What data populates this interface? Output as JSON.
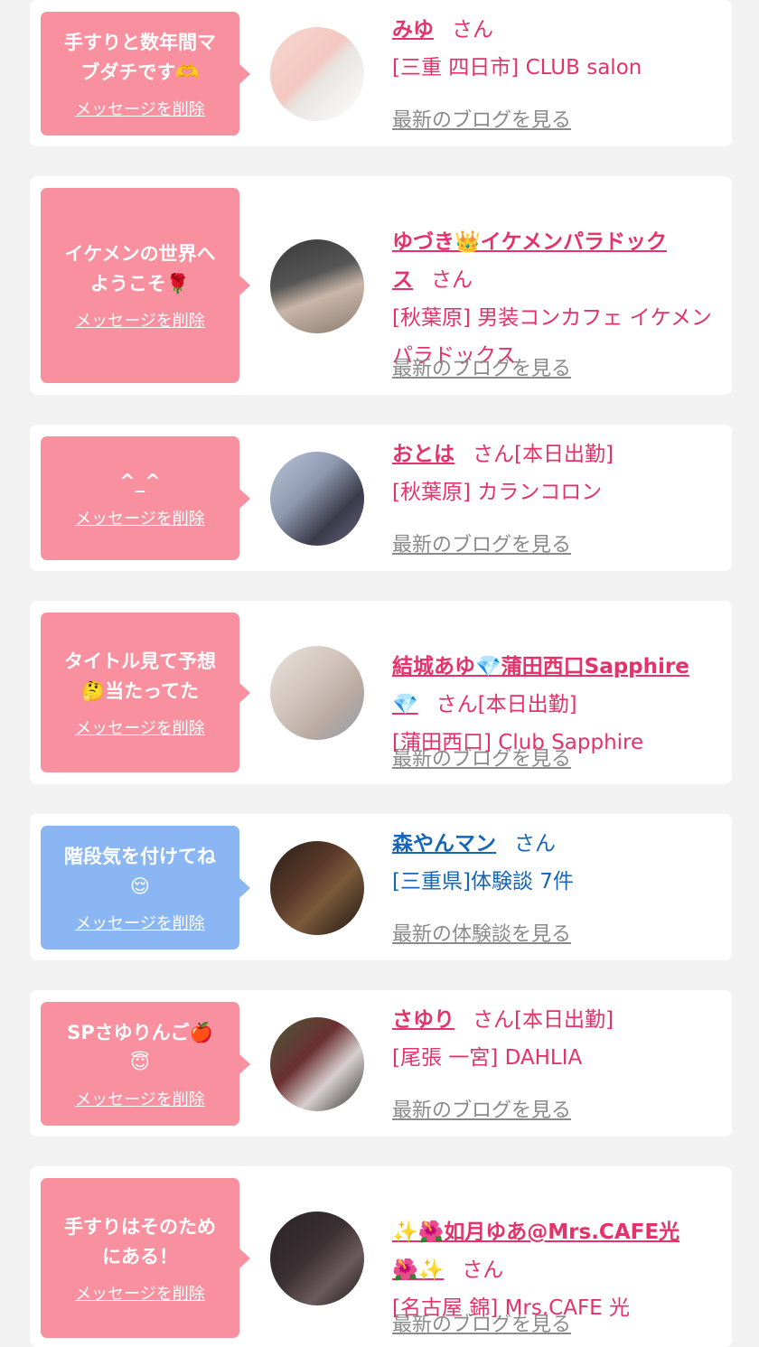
{
  "delete_label": "メッセージを削除",
  "san": "さん",
  "items": [
    {
      "message": "手すりと数年間マ\nブダチです🫶",
      "name": "みゆ",
      "status": "",
      "shop": "[三重 四日市] CLUB salon",
      "blog": "最新のブログを見る",
      "bubble_color": "pink",
      "avatar_colors": [
        "#f5d8d0",
        "#e8e4e2"
      ]
    },
    {
      "message": "イケメンの世界へ\nようこそ🌹",
      "name": "ゆづき👑イケメンパラドック\nス",
      "status": "",
      "shop": "[秋葉原] 男装コンカフェ イケメンパラドックス",
      "blog": "最新のブログを見る",
      "bubble_color": "pink",
      "avatar_colors": [
        "#3a3a3a",
        "#c9b6a8"
      ]
    },
    {
      "message": "^_^",
      "name": "おとは",
      "status": "[本日出勤]",
      "shop": "[秋葉原] カランコロン",
      "blog": "最新のブログを見る",
      "bubble_color": "pink",
      "avatar_colors": [
        "#b9c4d8",
        "#3b3b4a"
      ]
    },
    {
      "message": "タイトル見て予想\n🤔当たってた",
      "name": "結城あゆ💎蒲田西口Sapphire\n💎",
      "status": "[本日出勤]",
      "shop": "[蒲田西口] Club Sapphire",
      "blog": "最新のブログを見る",
      "bubble_color": "pink",
      "avatar_colors": [
        "#e9e2dc",
        "#b8a8a0"
      ]
    },
    {
      "message": "階段気を付けてね\n😌",
      "name": "森やんマン",
      "status": "",
      "shop": "[三重県]体験談 7件",
      "blog": "最新の体験談を見る",
      "bubble_color": "blue",
      "avatar_colors": [
        "#2b1f1a",
        "#7a5a3a"
      ]
    },
    {
      "message": "SPさゆりんご🍎\n😇",
      "name": "さゆり",
      "status": "[本日出勤]",
      "shop": "[尾張 一宮] DAHLIA",
      "blog": "最新のブログを見る",
      "bubble_color": "pink",
      "avatar_colors": [
        "#4a5a3a",
        "#d8d0d0"
      ]
    },
    {
      "message": "手すりはそのため\nにある！",
      "name": "✨🌺如月ゆあ@Mrs.CAFE光\n🌺✨",
      "status": "",
      "shop": "[名古屋 錦] Mrs.CAFE 光",
      "blog": "最新のブログを見る",
      "bubble_color": "pink",
      "avatar_colors": [
        "#2a2326",
        "#6b5a5e"
      ]
    }
  ]
}
